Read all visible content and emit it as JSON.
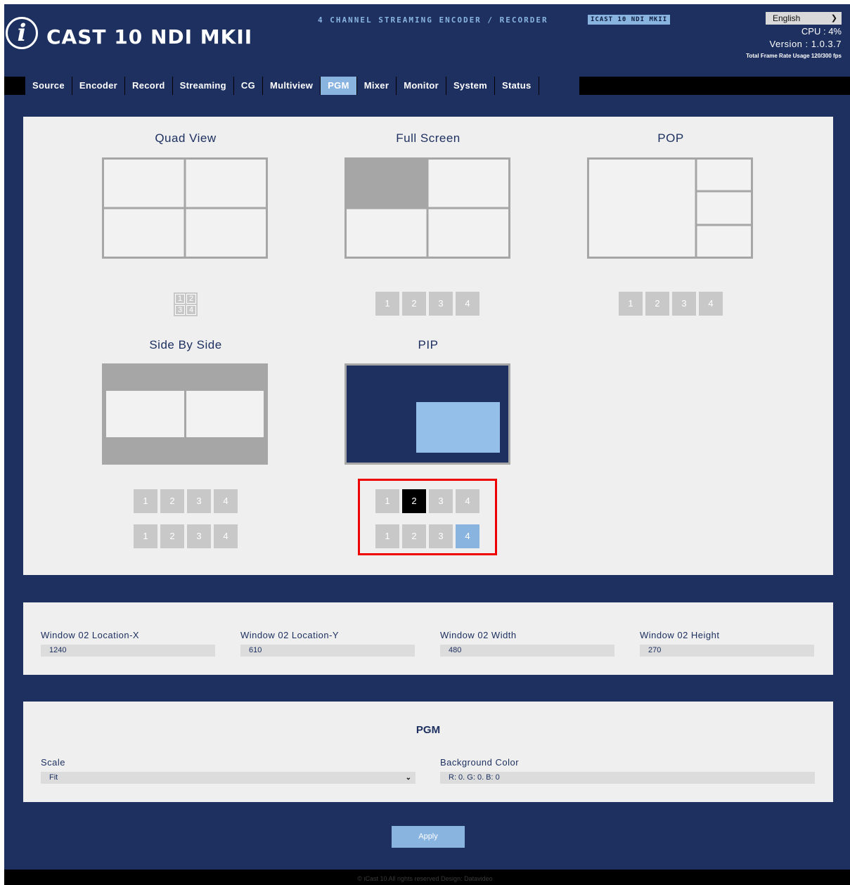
{
  "header": {
    "logo_glyph": "i",
    "logo_text": "CAST 10 NDI MKII",
    "tagline": "4 CHANNEL STREAMING ENCODER / RECORDER",
    "tag_badge": "ICAST 10 NDI MKII",
    "language": "English",
    "cpu": "CPU  : 4%",
    "version": "Version : 1.0.3.7",
    "frame_rate": "Total Frame Rate Usage 120/300 fps"
  },
  "nav": {
    "tabs": [
      "Source",
      "Encoder",
      "Record",
      "Streaming",
      "CG",
      "Multiview",
      "PGM",
      "Mixer",
      "Monitor",
      "System",
      "Status"
    ],
    "active": "PGM"
  },
  "layouts": {
    "quad_view": {
      "title": "Quad View",
      "grid": [
        "1",
        "2",
        "3",
        "4"
      ]
    },
    "full_screen": {
      "title": "Full Screen",
      "buttons": [
        "1",
        "2",
        "3",
        "4"
      ]
    },
    "pop": {
      "title": "POP",
      "buttons": [
        "1",
        "2",
        "3",
        "4"
      ]
    },
    "side_by_side": {
      "title": "Side By Side",
      "row1": [
        "1",
        "2",
        "3",
        "4"
      ],
      "row2": [
        "1",
        "2",
        "3",
        "4"
      ]
    },
    "pip": {
      "title": "PIP",
      "row1": [
        "1",
        "2",
        "3",
        "4"
      ],
      "row2": [
        "1",
        "2",
        "3",
        "4"
      ],
      "row1_selected": "2",
      "row2_selected": "4"
    }
  },
  "window_settings": {
    "location_x_label": "Window 02 Location-X",
    "location_x": "1240",
    "location_y_label": "Window 02 Location-Y",
    "location_y": "610",
    "width_label": "Window 02 Width",
    "width": "480",
    "height_label": "Window 02 Height",
    "height": "270"
  },
  "pgm": {
    "title": "PGM",
    "scale_label": "Scale",
    "scale_value": "Fit",
    "bg_label": "Background Color",
    "bg_value": "R: 0. G: 0. B: 0"
  },
  "apply_label": "Apply",
  "footer": "© iCast 10 All rights reserved Design: Datavideo",
  "colors": {
    "navy": "#1d3060",
    "accent_blue": "#8ab4e0",
    "panel": "#efefef",
    "button_gray": "#c8c8c8",
    "highlight_red": "#e00000"
  }
}
